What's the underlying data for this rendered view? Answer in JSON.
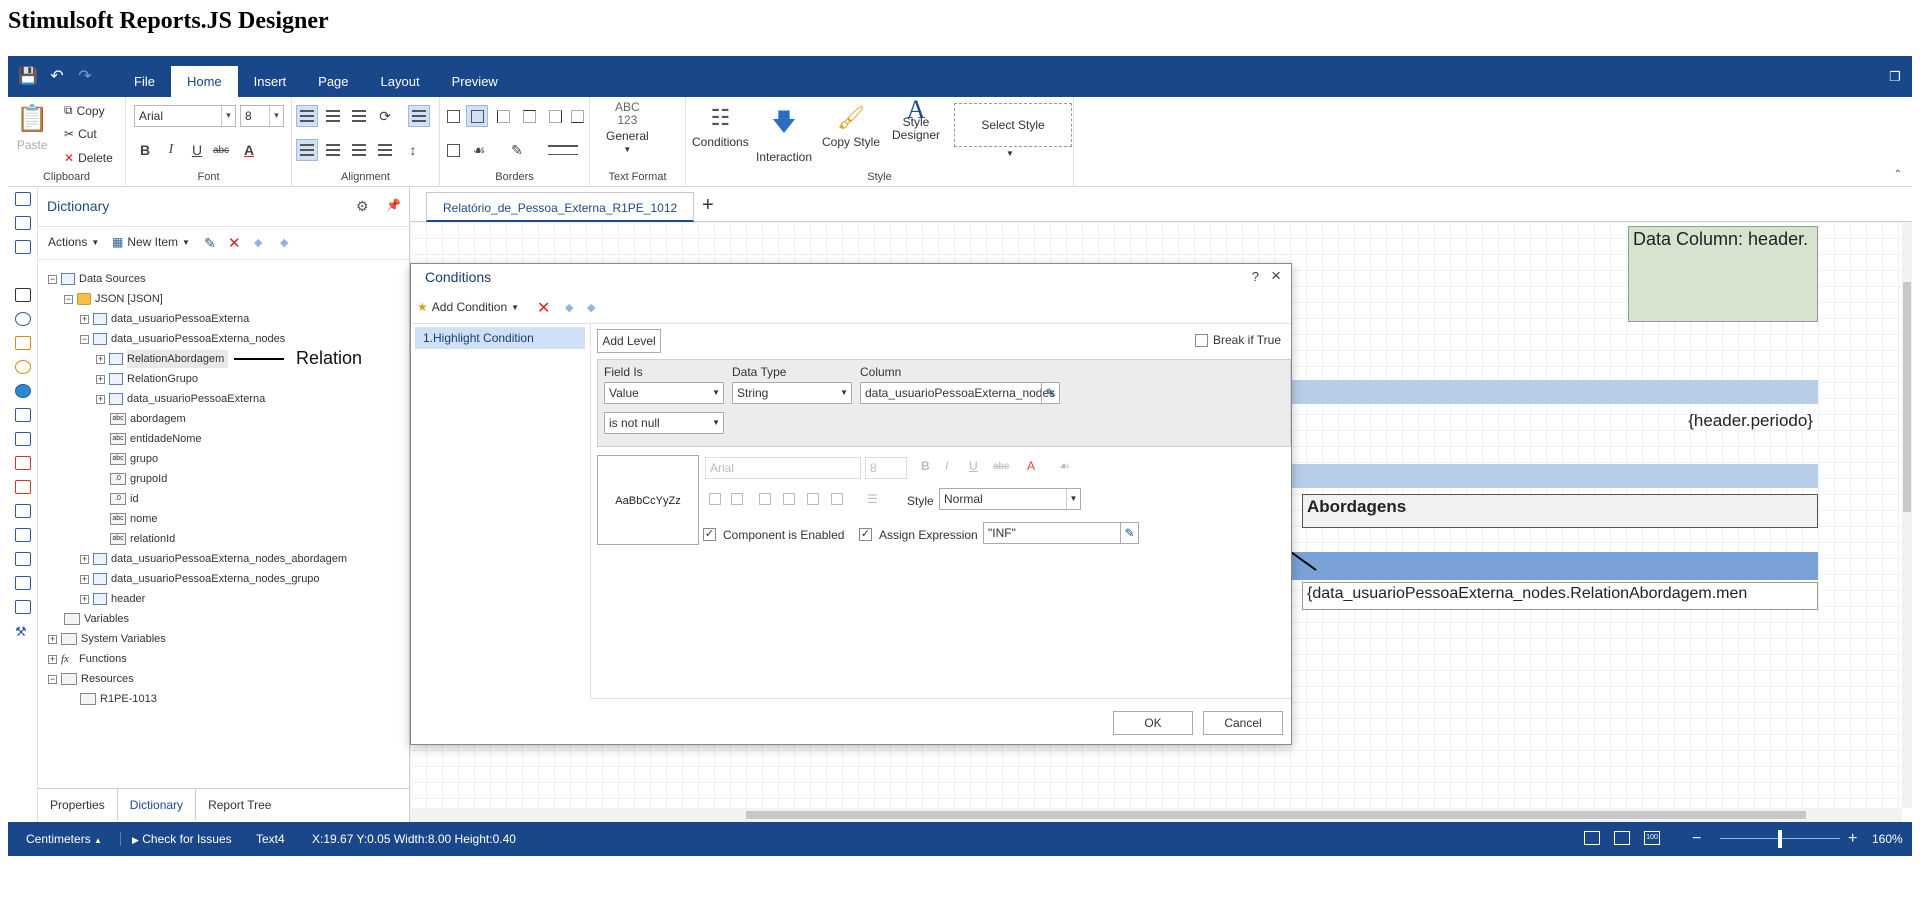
{
  "page": {
    "title": "Stimulsoft Reports.JS Designer"
  },
  "menu": {
    "tabs": [
      {
        "label": "File"
      },
      {
        "label": "Home"
      },
      {
        "label": "Insert"
      },
      {
        "label": "Page"
      },
      {
        "label": "Layout"
      },
      {
        "label": "Preview"
      }
    ],
    "active_tab": "Home"
  },
  "ribbon": {
    "clipboard": {
      "paste": "Paste",
      "copy": "Copy",
      "cut": "Cut",
      "delete": "Delete",
      "label": "Clipboard"
    },
    "font": {
      "family": "Arial",
      "size": "8",
      "label": "Font",
      "bold": "B",
      "italic": "I",
      "underline": "U",
      "strike": "abc",
      "color": "A"
    },
    "alignment": {
      "label": "Alignment"
    },
    "borders": {
      "label": "Borders"
    },
    "text_format": {
      "icon_text": "ABC 123",
      "value": "General",
      "label": "Text Format"
    },
    "style": {
      "conditions": "Conditions",
      "interaction": "Interaction",
      "copy_style": "Copy Style",
      "style_designer_1": "Style",
      "style_designer_2": "Designer",
      "select_style": "Select Style",
      "label": "Style"
    }
  },
  "dictionary": {
    "title": "Dictionary",
    "actions": "Actions",
    "new_item": "New Item",
    "tree": [
      {
        "label": "Data Sources"
      },
      {
        "label": "JSON [JSON]"
      },
      {
        "label": "data_usuarioPessoaExterna"
      },
      {
        "label": "data_usuarioPessoaExterna_nodes"
      },
      {
        "label": "RelationAbordagem"
      },
      {
        "label": "RelationGrupo"
      },
      {
        "label": "data_usuarioPessoaExterna"
      },
      {
        "label": "abordagem"
      },
      {
        "label": "entidadeNome"
      },
      {
        "label": "grupo"
      },
      {
        "label": "grupoId"
      },
      {
        "label": "id"
      },
      {
        "label": "nome"
      },
      {
        "label": "relationId"
      },
      {
        "label": "data_usuarioPessoaExterna_nodes_abordagem"
      },
      {
        "label": "data_usuarioPessoaExterna_nodes_grupo"
      },
      {
        "label": "header"
      },
      {
        "label": "Variables"
      },
      {
        "label": "System Variables"
      },
      {
        "label": "Functions"
      },
      {
        "label": "Resources"
      },
      {
        "label": "R1PE-1013"
      }
    ],
    "annotation": "Relation",
    "bottom_tabs": [
      {
        "label": "Properties"
      },
      {
        "label": "Dictionary"
      },
      {
        "label": "Report Tree"
      }
    ]
  },
  "document": {
    "tab": "Relatório_de_Pessoa_Externa_R1PE_1012",
    "add_tab": "+",
    "components": {
      "data_column": "Data Column: header.",
      "periodo": "{header.periodo}",
      "abordagens": "Abordagens",
      "expression": "{data_usuarioPessoaExterna_nodes.RelationAbordagem.men"
    }
  },
  "dialog": {
    "title": "Conditions",
    "help": "?",
    "close": "×",
    "add_condition": "Add Condition",
    "condition_item": "1.Highlight Condition",
    "add_level": "Add Level",
    "break_if_true": "Break if True",
    "field_is_label": "Field Is",
    "field_is_value": "Value",
    "data_type_label": "Data Type",
    "data_type_value": "String",
    "column_label": "Column",
    "column_value": "data_usuarioPessoaExterna_nodes",
    "operator_value": "is not null",
    "preview_text": "AaBbCcYyZz",
    "font_family": "Arial",
    "font_size": "8",
    "style_label": "Style",
    "style_value": "Normal",
    "component_enabled": "Component is Enabled",
    "assign_expression": "Assign Expression",
    "expression_value": "\"INF\"",
    "ok": "OK",
    "cancel": "Cancel"
  },
  "statusbar": {
    "units": "Centimeters",
    "check_issues": "Check for Issues",
    "component": "Text4",
    "position": "X:19.67 Y:0.05 Width:8.00 Height:0.40",
    "zoom": "160%",
    "zoom_out": "−",
    "zoom_in": "+"
  }
}
